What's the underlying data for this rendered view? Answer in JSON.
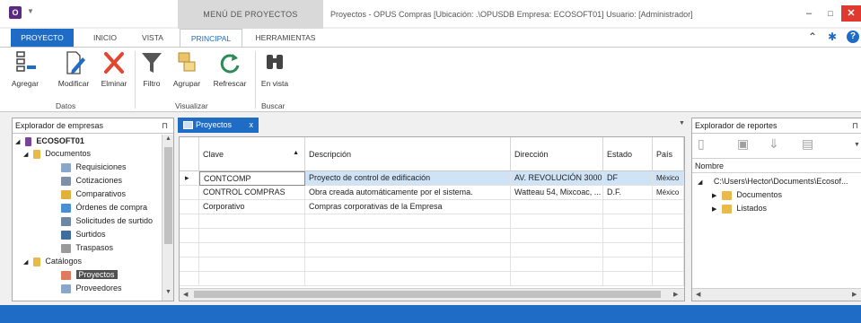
{
  "titlebar": {
    "context_group": "MENÚ DE PROYECTOS",
    "window_title": "Proyectos - OPUS Compras [Ubicación: .\\OPUSDB  Empresa: ECOSOFT01]  Usuario: [Administrador]",
    "minimize": "–",
    "maximize": "□",
    "close": "✕"
  },
  "tabs": {
    "file": "PROYECTO",
    "inicio": "INICIO",
    "vista": "VISTA",
    "principal": "PRINCIPAL",
    "herramientas": "HERRAMIENTAS"
  },
  "ribbon": {
    "agregar": "Agregar",
    "modificar": "Modificar",
    "eliminar": "Elminar",
    "filtro": "Filtro",
    "agrupar": "Agrupar",
    "refrescar": "Refrescar",
    "en_vista": "En vista",
    "group_datos": "Datos",
    "group_visualizar": "Visualizar",
    "group_buscar": "Buscar"
  },
  "explorer": {
    "title": "Explorador de empresas",
    "company": "ECOSOFT01",
    "documentos": "Documentos",
    "requisiciones": "Requisiciones",
    "cotizaciones": "Cotizaciones",
    "comparativos": "Comparativos",
    "ordenes": "Órdenes de compra",
    "solicitudes": "Solicitudes de surtido",
    "surtidos": "Surtidos",
    "traspasos": "Traspasos",
    "catalogos": "Catálogos",
    "proyectos": "Proyectos",
    "proveedores": "Proveedores"
  },
  "doc_tab": {
    "label": "Proyectos",
    "close": "x"
  },
  "grid": {
    "columns": [
      "Clave",
      "Descripción",
      "Dirección",
      "Estado",
      "País"
    ],
    "rows": [
      [
        "CONTCOMP",
        "Proyecto de control de edificación",
        "AV. REVOLUCIÓN 3000",
        "DF",
        "México"
      ],
      [
        "CONTROL COMPRAS",
        "Obra creada automáticamente por el sistema.",
        "Watteau 54, Mixcoac, ...",
        "D.F.",
        "México"
      ],
      [
        "Corporativo",
        "Compras corporativas de la Empresa",
        "",
        "",
        ""
      ]
    ]
  },
  "reports": {
    "title": "Explorador de reportes",
    "column": "Nombre",
    "path": "C:\\Users\\Hector\\Documents\\Ecosof...",
    "documentos": "Documentos",
    "listados": "Listados"
  },
  "colors": {
    "accent": "#1f6cc6",
    "close": "#e0392f",
    "selection": "#cfe3f7"
  }
}
